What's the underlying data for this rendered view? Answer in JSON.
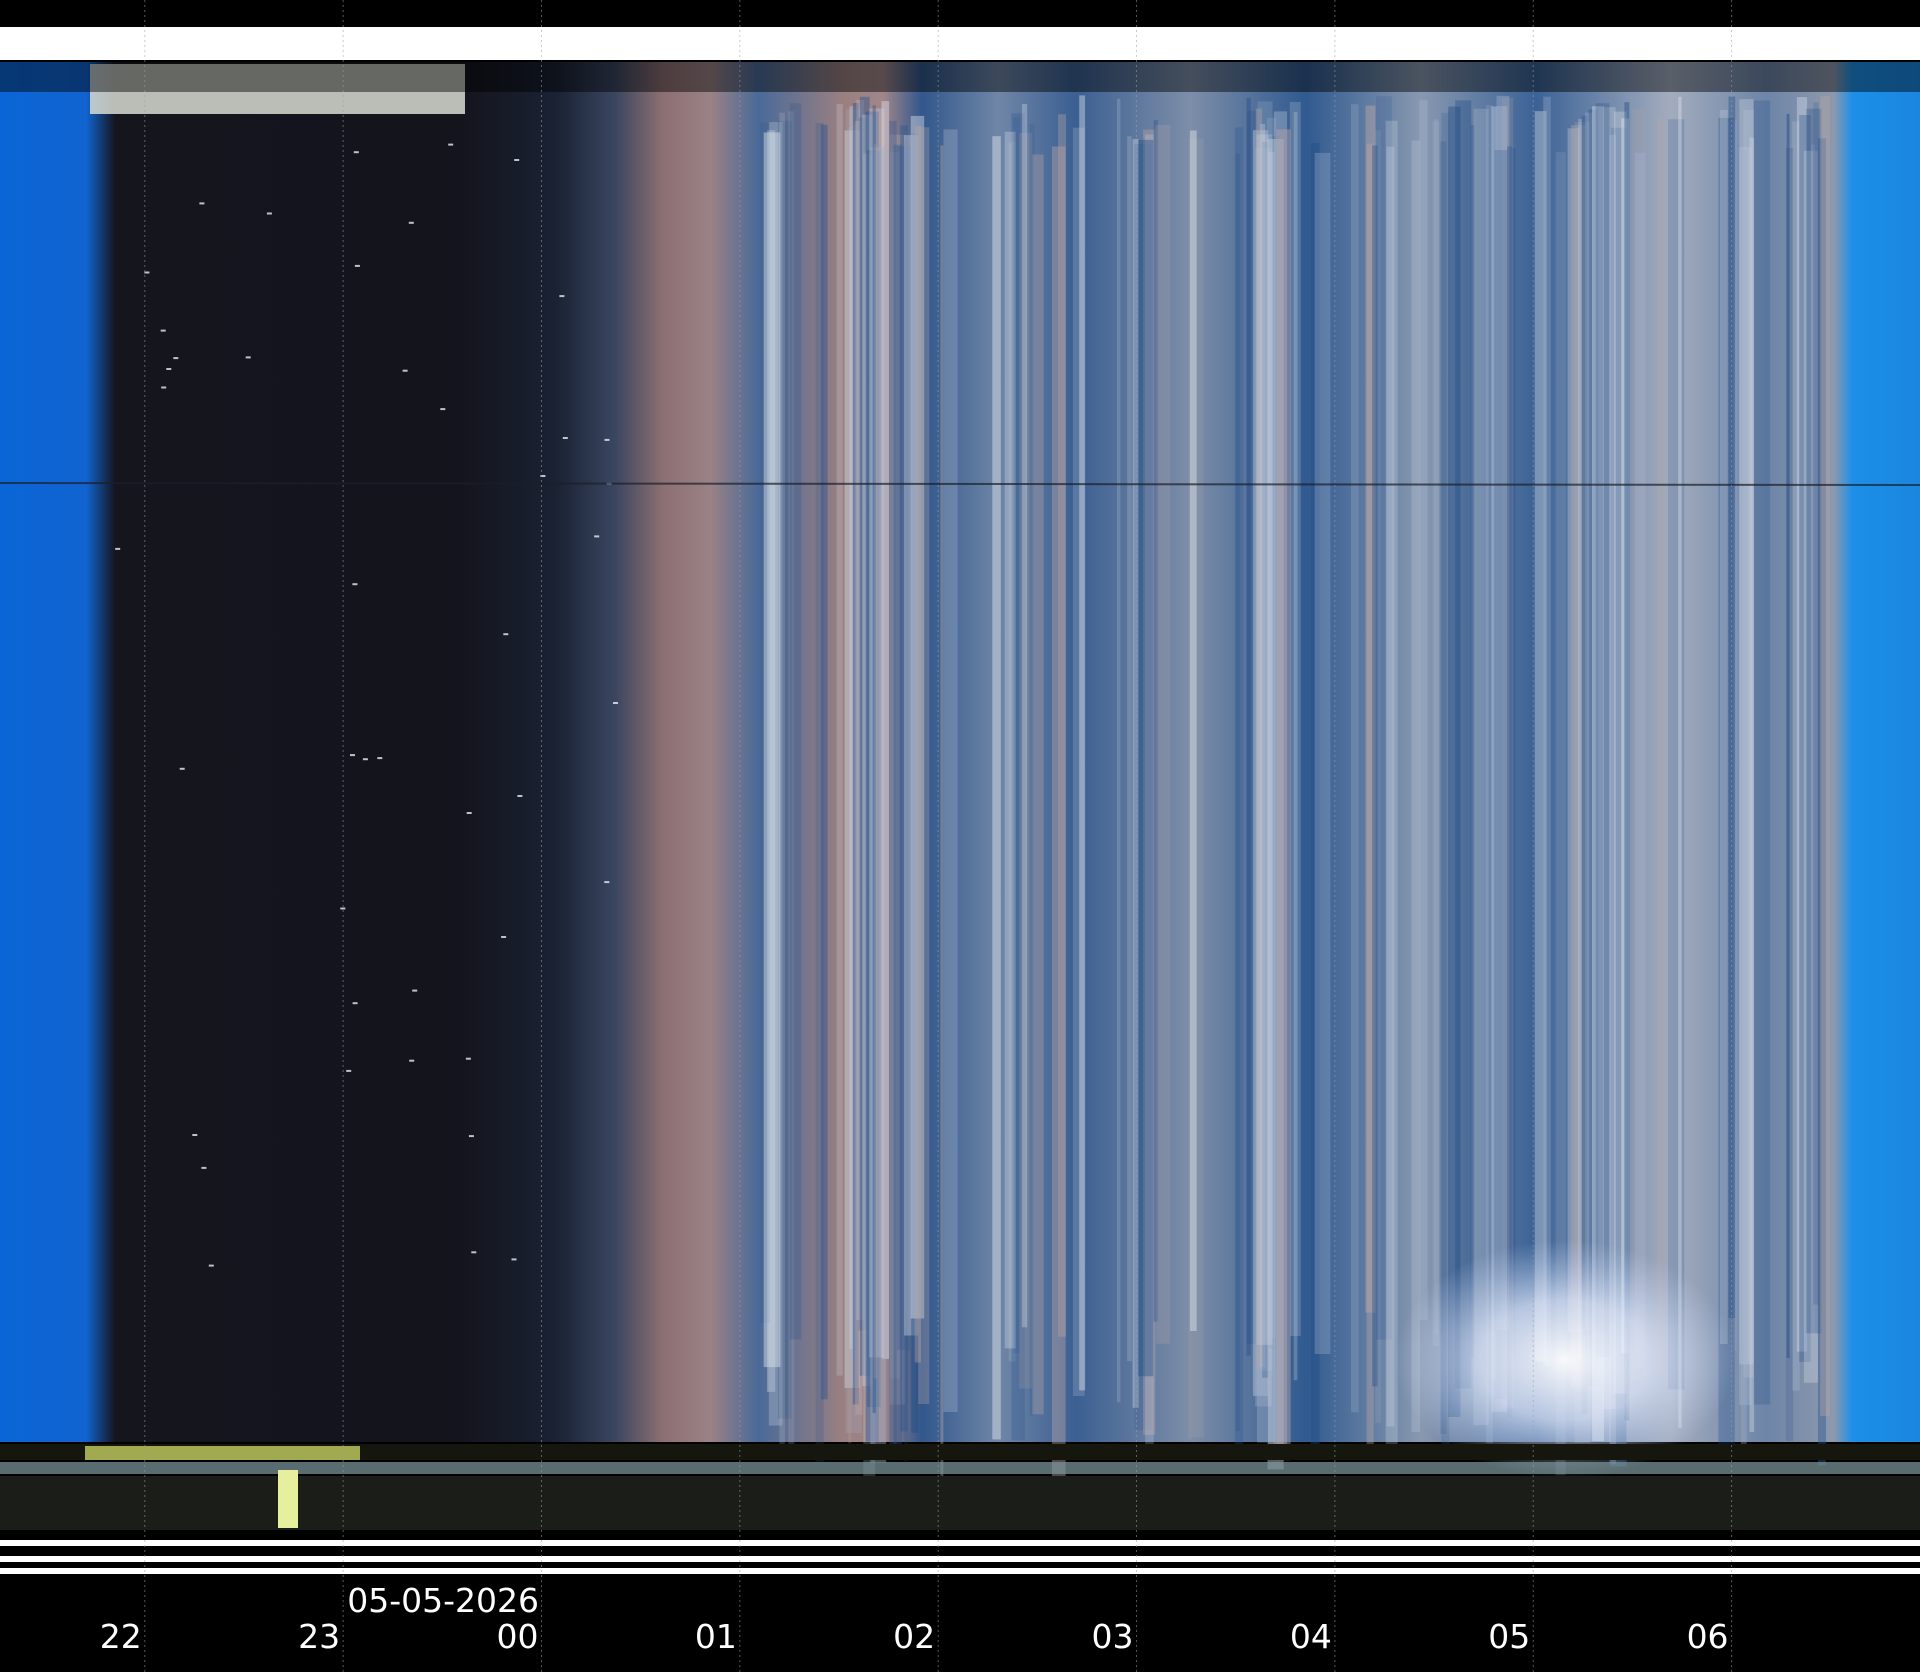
{
  "chart_data": {
    "type": "heatmap",
    "title": "",
    "xlabel": "",
    "ylabel": "",
    "date_label": "05-05-2026",
    "date_label_at_hour": 23,
    "x_ticks": [
      "22",
      "23",
      "00",
      "01",
      "02",
      "03",
      "04",
      "05",
      "06"
    ],
    "x_tick_hours": [
      22,
      23,
      24,
      25,
      26,
      27,
      28,
      29,
      30
    ],
    "x_range_hours": [
      21.27,
      30.95
    ],
    "grid": true,
    "phases": [
      {
        "name": "twilight-start",
        "from_hour": 21.27,
        "to_hour": 21.75,
        "color": "#0a66d6"
      },
      {
        "name": "night",
        "from_hour": 21.75,
        "to_hour": 24.4,
        "color": "#14141f"
      },
      {
        "name": "dawn",
        "from_hour": 24.4,
        "to_hour": 25.1,
        "color": "#8a6f72"
      },
      {
        "name": "cloudy-sky",
        "from_hour": 25.1,
        "to_hour": 30.55,
        "color": "#4d76ad"
      },
      {
        "name": "twilight-end",
        "from_hour": 30.55,
        "to_hour": 30.95,
        "color": "#1c8fe8"
      }
    ],
    "bright_spot": {
      "hour": 29.25,
      "color": "#f2f6ff"
    }
  }
}
